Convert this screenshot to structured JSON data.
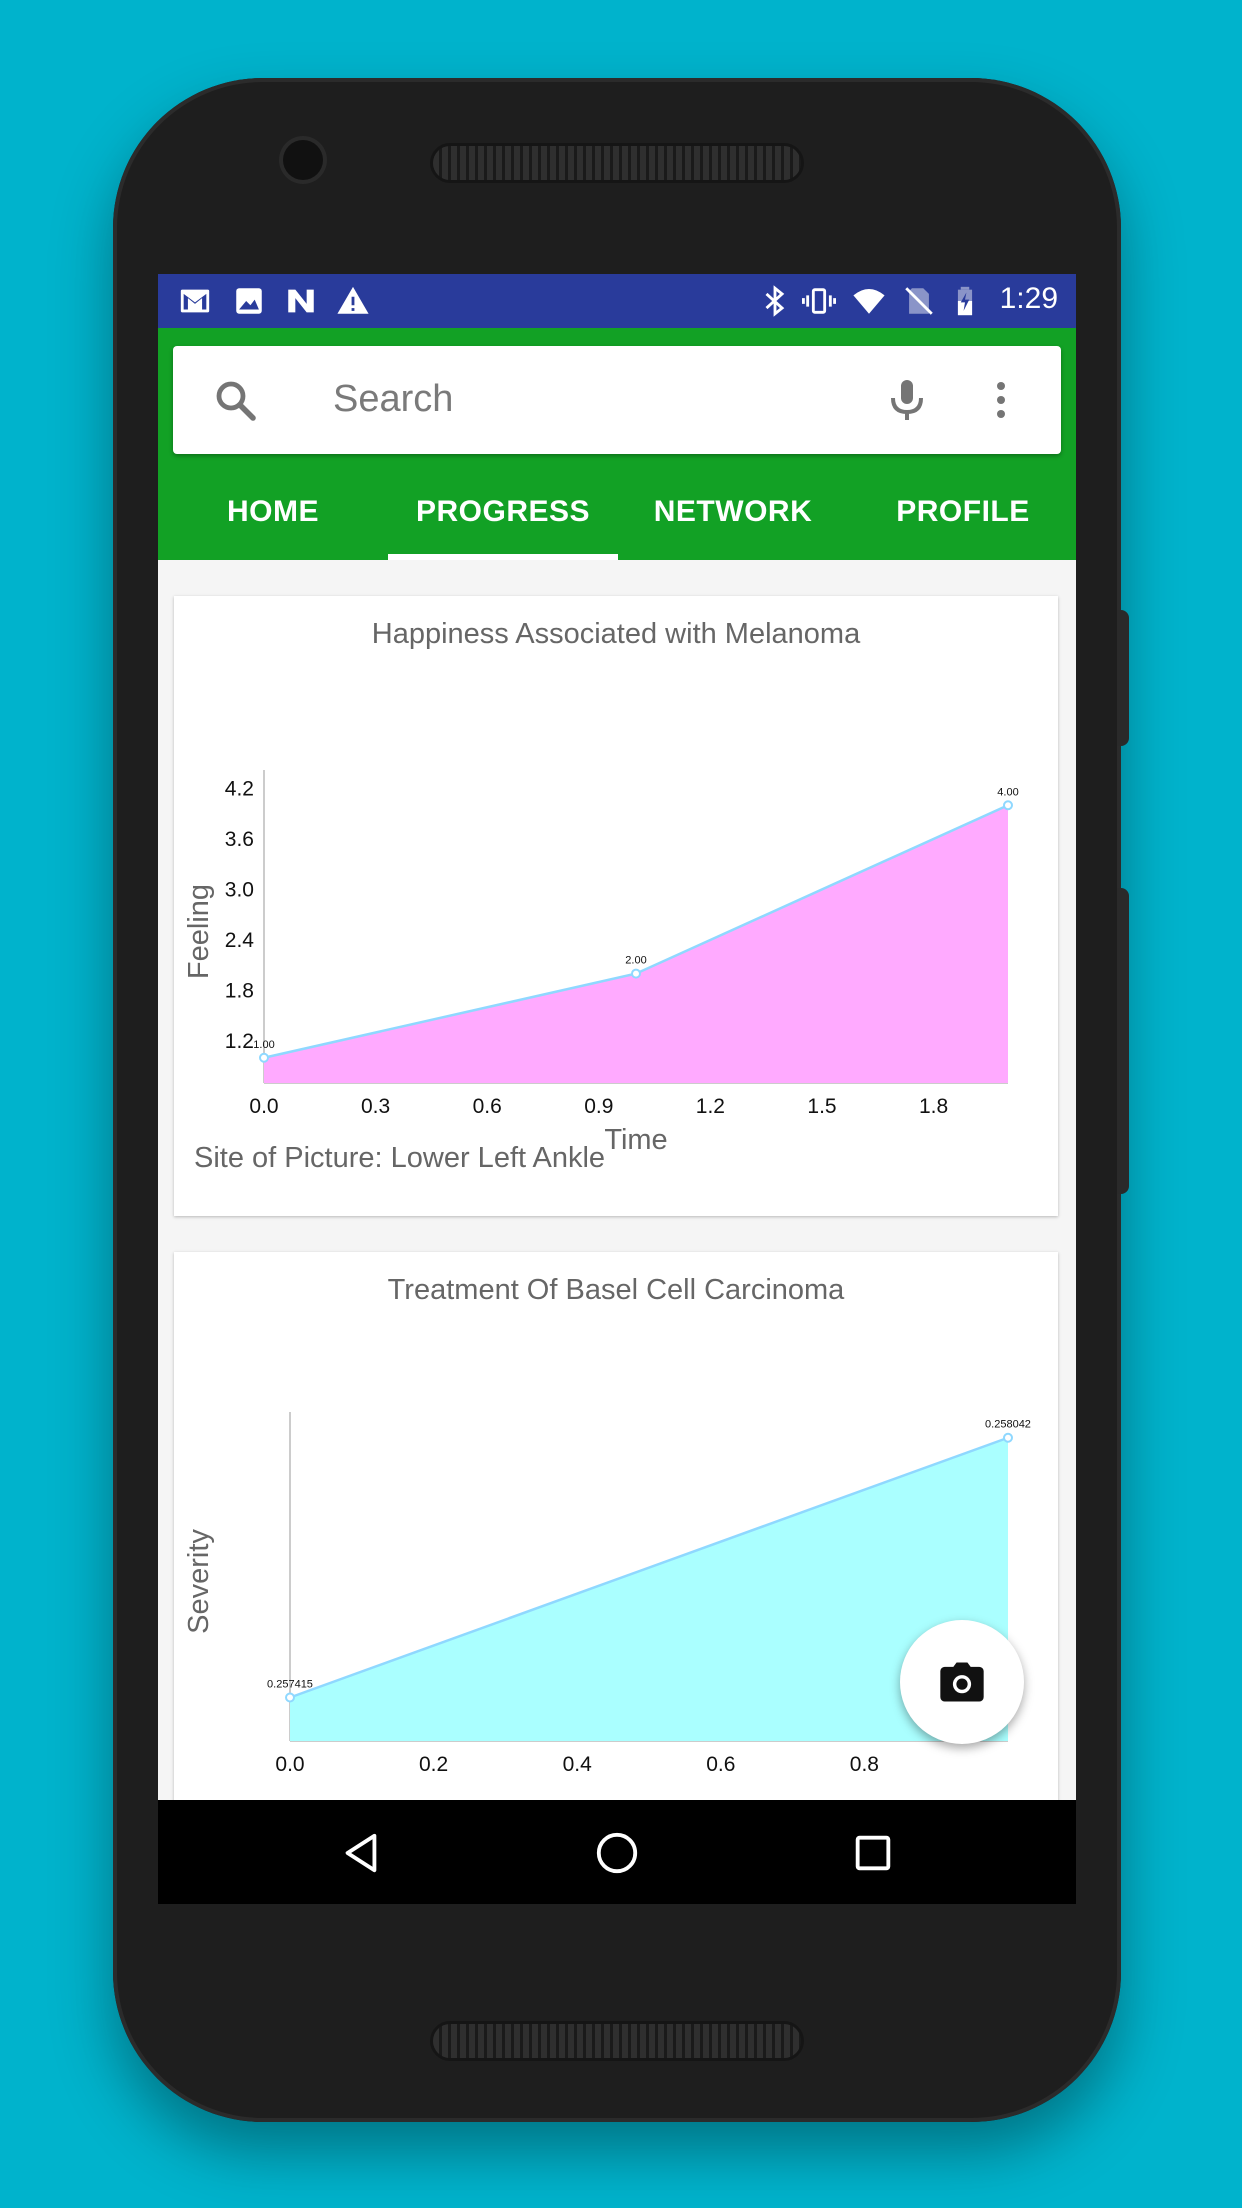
{
  "statusbar": {
    "time": "1:29",
    "left_icons": [
      "gmail-icon",
      "image-icon",
      "n-icon",
      "warning-icon"
    ],
    "right_icons": [
      "bluetooth-icon",
      "vibrate-icon",
      "wifi-icon",
      "no-sim-icon",
      "battery-charging-icon"
    ]
  },
  "search": {
    "placeholder": "Search"
  },
  "tabs": [
    {
      "label": "HOME"
    },
    {
      "label": "PROGRESS"
    },
    {
      "label": "NETWORK"
    },
    {
      "label": "PROFILE"
    }
  ],
  "selected_tab": "PROGRESS",
  "cards": [
    {
      "title": "Happiness Associated with Melanoma",
      "note": "Site of Picture: Lower Left Ankle"
    },
    {
      "title": "Treatment Of Basel Cell Carcinoma"
    }
  ],
  "colors": {
    "status_bar": "#293b9b",
    "app_bar": "#12a125",
    "chart1_fill": "#ffaaff",
    "chart2_fill": "#aaffff",
    "line": "#8fd8ff"
  },
  "chart_data": [
    {
      "type": "area",
      "title": "Happiness Associated with Melanoma",
      "xlabel": "Time",
      "ylabel": "Feeling",
      "x": [
        0,
        1,
        2
      ],
      "y": [
        1.0,
        2.0,
        4.0
      ],
      "point_labels": [
        "1.00",
        "2.00",
        "4.00"
      ],
      "x_ticks": [
        "0.0",
        "0.3",
        "0.6",
        "0.9",
        "1.2",
        "1.5",
        "1.8"
      ],
      "y_ticks": [
        "1.2",
        "1.8",
        "2.4",
        "3.0",
        "3.6",
        "4.2"
      ],
      "xlim": [
        0,
        2
      ],
      "ylim": [
        0.7,
        4.3
      ]
    },
    {
      "type": "area",
      "title": "Treatment Of Basel Cell Carcinoma",
      "xlabel": "",
      "ylabel": "Severity",
      "x": [
        0,
        1
      ],
      "y": [
        0.257415,
        0.258042
      ],
      "point_labels": [
        "0.257415",
        "0.258042"
      ],
      "x_ticks": [
        "0.0",
        "0.2",
        "0.4",
        "0.6",
        "0.8"
      ],
      "y_ticks": [],
      "xlim": [
        0,
        1
      ],
      "ylim": [
        0.25731,
        0.25808
      ]
    }
  ],
  "fab": {
    "icon": "camera-icon"
  },
  "navbar": {
    "icons": [
      "back-icon",
      "home-icon",
      "recents-icon"
    ]
  }
}
